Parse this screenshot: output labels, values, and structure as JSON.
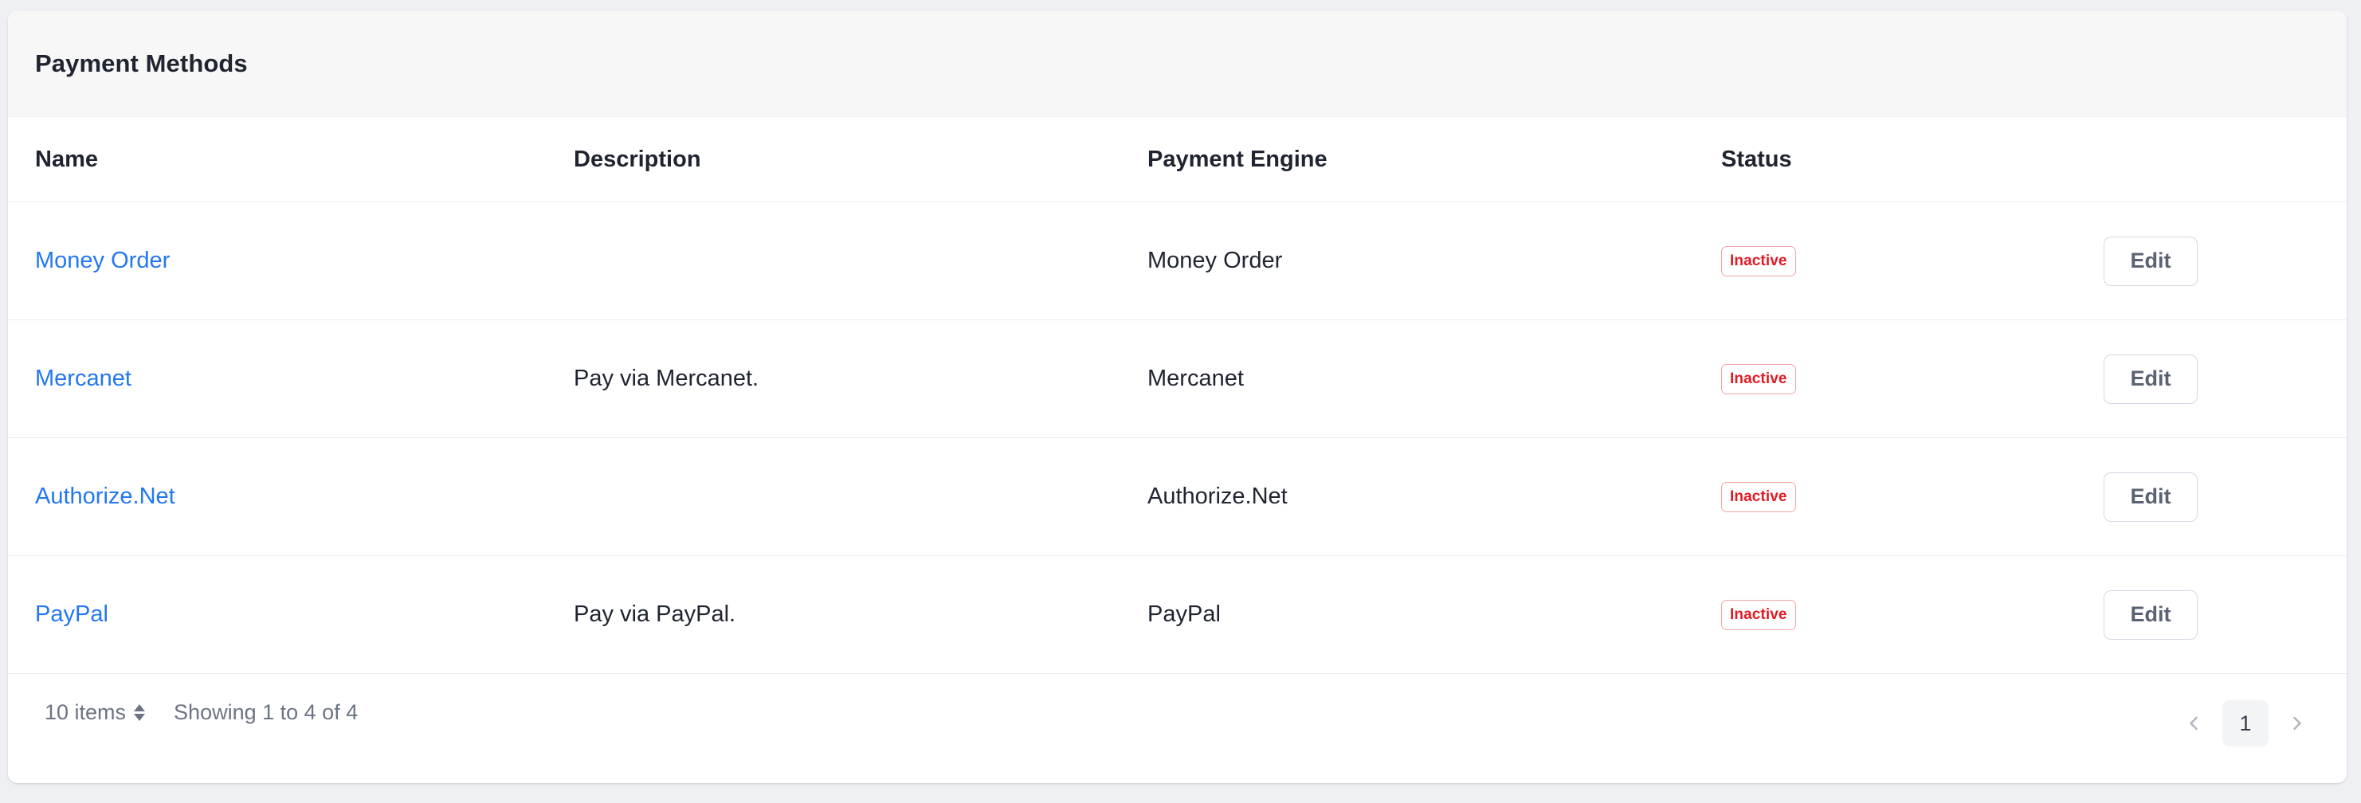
{
  "card": {
    "title": "Payment Methods"
  },
  "table": {
    "columns": [
      {
        "key": "name",
        "label": "Name"
      },
      {
        "key": "description",
        "label": "Description"
      },
      {
        "key": "engine",
        "label": "Payment Engine"
      },
      {
        "key": "status",
        "label": "Status"
      },
      {
        "key": "actions",
        "label": ""
      }
    ],
    "rows": [
      {
        "name": "Money Order",
        "description": "",
        "engine": "Money Order",
        "status": "Inactive",
        "action_label": "Edit"
      },
      {
        "name": "Mercanet",
        "description": "Pay via Mercanet.",
        "engine": "Mercanet",
        "status": "Inactive",
        "action_label": "Edit"
      },
      {
        "name": "Authorize.Net",
        "description": "",
        "engine": "Authorize.Net",
        "status": "Inactive",
        "action_label": "Edit"
      },
      {
        "name": "PayPal",
        "description": "Pay via PayPal.",
        "engine": "PayPal",
        "status": "Inactive",
        "action_label": "Edit"
      }
    ]
  },
  "footer": {
    "page_size_label": "10 items",
    "showing_text": "Showing 1 to 4 of 4",
    "pagination": {
      "prev_icon": "chevron-left-icon",
      "next_icon": "chevron-right-icon",
      "current_page": "1"
    }
  },
  "colors": {
    "link": "#2377f0",
    "badge_text": "#e01b24",
    "badge_border": "#f3a3a3",
    "page_background": "#eef0f4",
    "card_header_background": "#f7f7f8",
    "muted_text": "#6c7384",
    "heading_text": "#1f2430"
  }
}
